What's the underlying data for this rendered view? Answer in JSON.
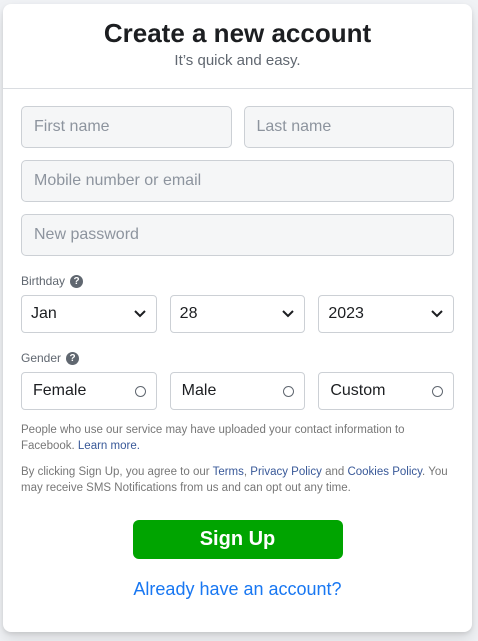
{
  "header": {
    "title": "Create a new account",
    "subtitle": "It’s quick and easy."
  },
  "form": {
    "first_name": {
      "placeholder": "First name",
      "value": ""
    },
    "last_name": {
      "placeholder": "Last name",
      "value": ""
    },
    "contact": {
      "placeholder": "Mobile number or email",
      "value": ""
    },
    "password": {
      "placeholder": "New password",
      "value": ""
    },
    "birthday": {
      "label": "Birthday",
      "month": "Jan",
      "day": "28",
      "year": "2023"
    },
    "gender": {
      "label": "Gender",
      "options": [
        "Female",
        "Male",
        "Custom"
      ]
    }
  },
  "notes": {
    "contact_info": "People who use our service may have uploaded your contact information to Facebook.",
    "learn_more": "Learn more.",
    "terms_prefix": "By clicking Sign Up, you agree to our",
    "terms": "Terms",
    "privacy": "Privacy Policy",
    "and": "and",
    "cookies": "Cookies Policy",
    "sms": "You may receive SMS Notifications from us and can opt out any time."
  },
  "actions": {
    "signup_label": "Sign Up",
    "already_label": "Already have an account?"
  },
  "icons": {
    "help": "question-circle-icon",
    "chevron": "chevron-down-icon",
    "radio": "radio-unchecked-icon"
  },
  "colors": {
    "signup": "#00a400",
    "link": "#1877f2",
    "text_link": "#385898"
  }
}
